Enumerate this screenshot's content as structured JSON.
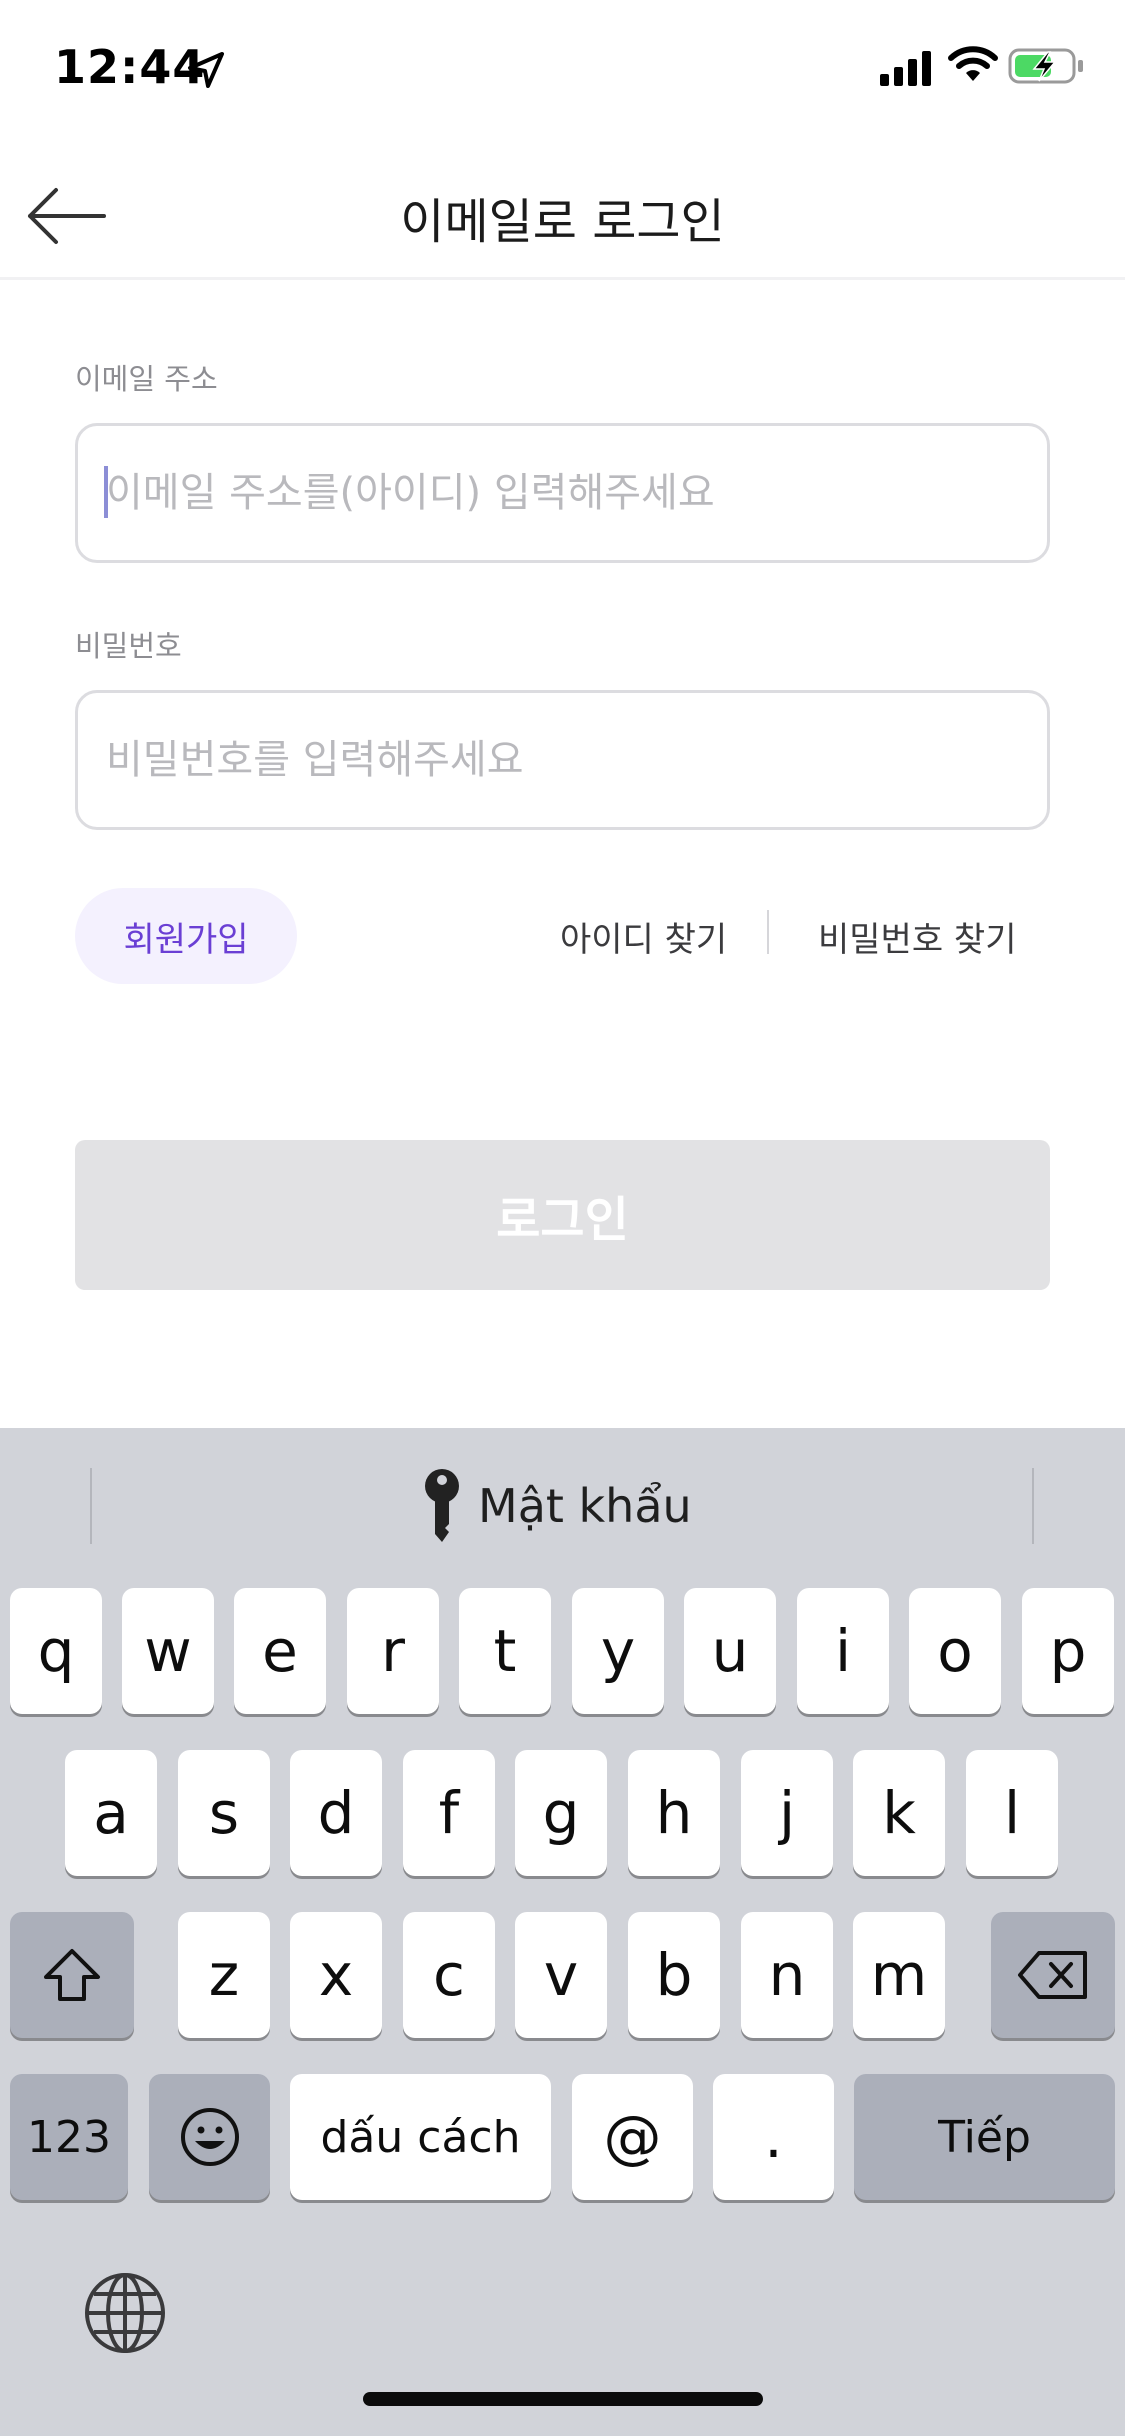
{
  "status_bar": {
    "time": "12:44"
  },
  "nav": {
    "title": "이메일로 로그인"
  },
  "form": {
    "email_label": "이메일 주소",
    "email_placeholder": "이메일 주소를(아이디) 입력해주세요",
    "email_value": "",
    "password_label": "비밀번호",
    "password_placeholder": "비밀번호를 입력해주세요",
    "password_value": ""
  },
  "links": {
    "signup": "회원가입",
    "find_id": "아이디 찾기",
    "find_password": "비밀번호 찾기"
  },
  "login_button": "로그인",
  "keyboard": {
    "suggestion": "Mật khẩu",
    "row1": [
      "q",
      "w",
      "e",
      "r",
      "t",
      "y",
      "u",
      "i",
      "o",
      "p"
    ],
    "row2": [
      "a",
      "s",
      "d",
      "f",
      "g",
      "h",
      "j",
      "k",
      "l"
    ],
    "row3": [
      "z",
      "x",
      "c",
      "v",
      "b",
      "n",
      "m"
    ],
    "numbers_key": "123",
    "emoji_key": "☺",
    "space_key": "dấu cách",
    "at_key": "@",
    "dot_key": ".",
    "return_key": "Tiếp"
  },
  "colors": {
    "accent": "#6a3fd4",
    "signup_bg": "#f4f1fe",
    "keyboard_bg": "#d1d3d9",
    "login_disabled": "#e2e2e4"
  }
}
